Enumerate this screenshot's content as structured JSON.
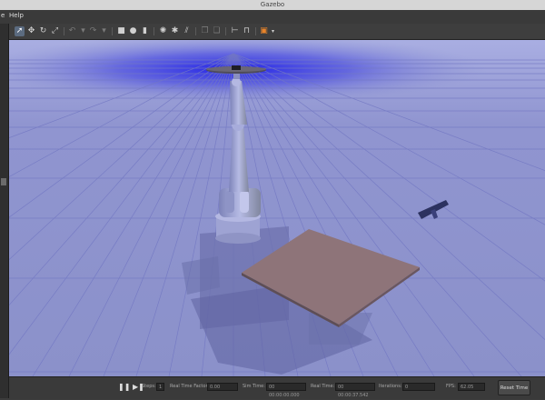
{
  "window": {
    "title": "Gazebo"
  },
  "menu": {
    "items": [
      "e",
      "Help"
    ]
  },
  "toolbar": {
    "tools": [
      "select-mode-icon",
      "translate-mode-icon",
      "rotate-mode-icon",
      "scale-mode-icon",
      "undo-icon",
      "redo-icon",
      "box-shape-icon",
      "sphere-shape-icon",
      "cylinder-shape-icon",
      "point-light-icon",
      "spot-light-icon",
      "directional-light-icon",
      "copy-icon",
      "paste-icon",
      "align-icon",
      "snap-icon",
      "change-view-icon",
      "screenshot-icon",
      "record-icon"
    ]
  },
  "bottom": {
    "steps_label": "Steps:",
    "steps_value": "1",
    "rtf_label": "Real Time Factor:",
    "rtf_value": "0.00",
    "sim_time_label": "Sim Time:",
    "sim_time_value": "00 00:00:00.000",
    "real_time_label": "Real Time:",
    "real_time_value": "00 00:00:37.542",
    "iterations_label": "Iterations:",
    "iterations_value": "0",
    "fps_label": "FPS:",
    "fps_value": "62.05",
    "reset_label": "Reset Time"
  }
}
